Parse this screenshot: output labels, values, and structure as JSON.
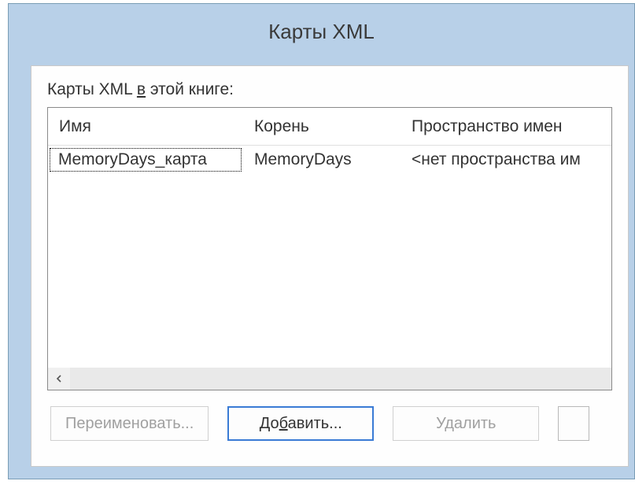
{
  "title": "Карты XML",
  "label_prefix": "Карты XML ",
  "label_underline": "в",
  "label_suffix": " этой книге:",
  "columns": {
    "name": "Имя",
    "root": "Корень",
    "namespace": "Пространство имен"
  },
  "rows": [
    {
      "name": "MemoryDays_карта",
      "root": "MemoryDays",
      "ns": "<нет пространства им"
    }
  ],
  "buttons": {
    "rename": "Переименовать...",
    "add_prefix": "До",
    "add_underline": "б",
    "add_suffix": "авить...",
    "delete": "Удалить"
  }
}
